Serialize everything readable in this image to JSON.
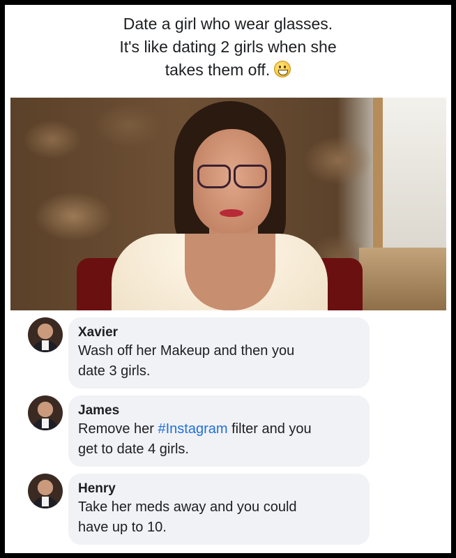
{
  "post": {
    "caption_lines": [
      "Date a girl who wear glasses.",
      "It's like dating 2 girls when she",
      "takes them off."
    ],
    "caption_emoji": "grinning-face-emoji"
  },
  "comments": [
    {
      "author": "Xavier",
      "text_line1": "Wash off her Makeup and then you",
      "text_line2": "date 3 girls."
    },
    {
      "author": "James",
      "text_line1_pre": "Remove her ",
      "hashtag": "#Instagram",
      "text_line1_post": " filter and you",
      "text_line2": "get to date 4 girls."
    },
    {
      "author": "Henry",
      "text_line1": "Take her meds away and you could",
      "text_line2": "have up to 10."
    }
  ],
  "colors": {
    "bubble": "#f0f2f5",
    "hashtag": "#216fdb",
    "text": "#1c1e21"
  }
}
